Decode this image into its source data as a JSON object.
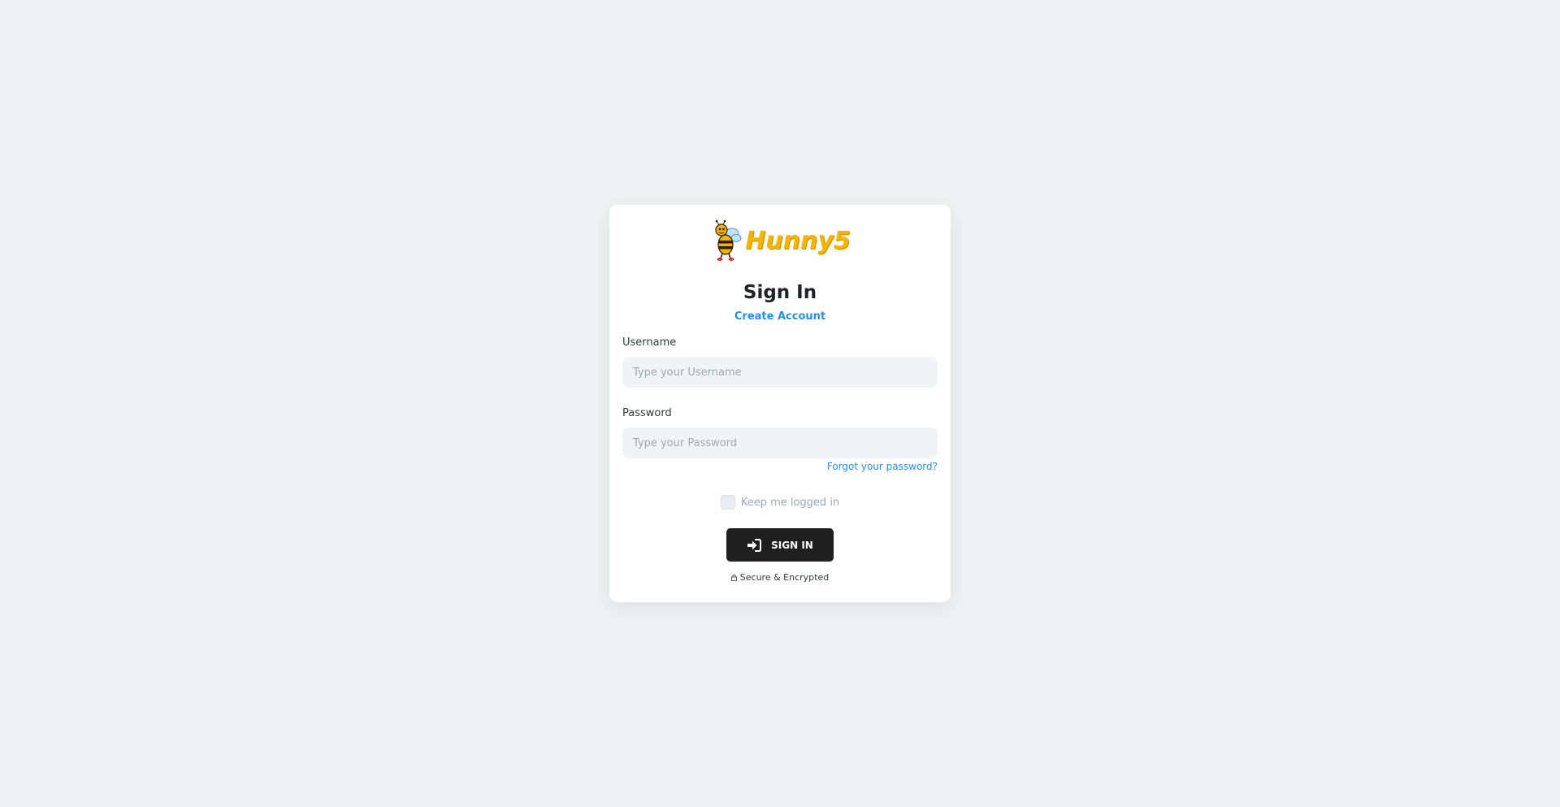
{
  "brand": {
    "name": "Hunny5",
    "mascot_icon": "bee-mascot-icon",
    "color": "#f5b400"
  },
  "form": {
    "title": "Sign In",
    "create_account_label": "Create Account",
    "username": {
      "label": "Username",
      "placeholder": "Type your Username",
      "value": ""
    },
    "password": {
      "label": "Password",
      "placeholder": "Type your Password",
      "value": ""
    },
    "forgot_label": "Forgot your password?",
    "remember": {
      "label": "Keep me logged in",
      "checked": false
    },
    "submit": {
      "label": "SIGN IN",
      "icon": "sign-in-icon"
    },
    "secure_note": {
      "label": "Secure & Encrypted",
      "icon": "lock-icon"
    }
  },
  "colors": {
    "link": "#2b8ed8",
    "button": "#1f1f1f",
    "background": "#eff1f3"
  }
}
